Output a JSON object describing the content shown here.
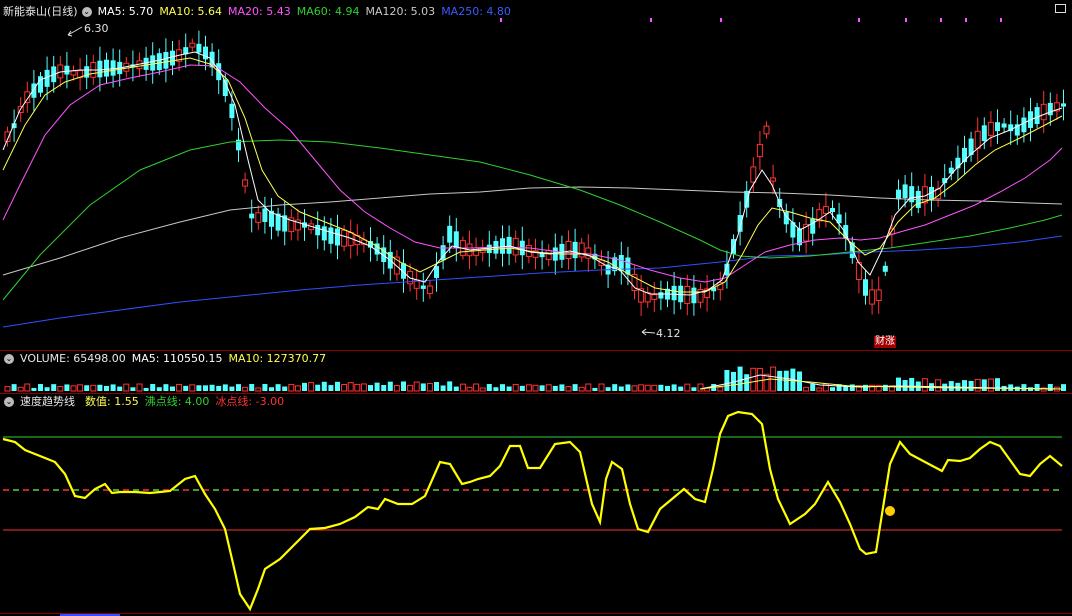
{
  "colors": {
    "up": "#ff3232",
    "down": "#54ffff",
    "ma5": "#ffffff",
    "ma10": "#ffff54",
    "ma20": "#ff54ff",
    "ma60": "#30d030",
    "ma120": "#c8c8c8",
    "ma250": "#3050ff",
    "indicator": "#ffff00",
    "boil": "#30d030",
    "zero": "#ff3232",
    "freeze": "#ff3232"
  },
  "price_panel": {
    "title": "新能泰山(日线)",
    "ma5": "MA5: 5.70",
    "ma10": "MA10: 5.64",
    "ma20": "MA20: 5.43",
    "ma60": "MA60: 4.94",
    "ma120": "MA120: 5.03",
    "ma250": "MA250: 4.80",
    "high_label": "6.30",
    "low_label": "4.12",
    "signal_label": "财涨"
  },
  "volume_panel": {
    "volume": "VOLUME: 65498.00",
    "ma5": "MA5: 110550.15",
    "ma10": "MA10: 127370.77"
  },
  "indicator_panel": {
    "name": "速度趋势线",
    "value": "数值: 1.55",
    "boil": "沸点线: 4.00",
    "freeze": "冰点线: -3.00"
  },
  "icons": [
    "collapse-icon",
    "maximize-icon"
  ]
}
